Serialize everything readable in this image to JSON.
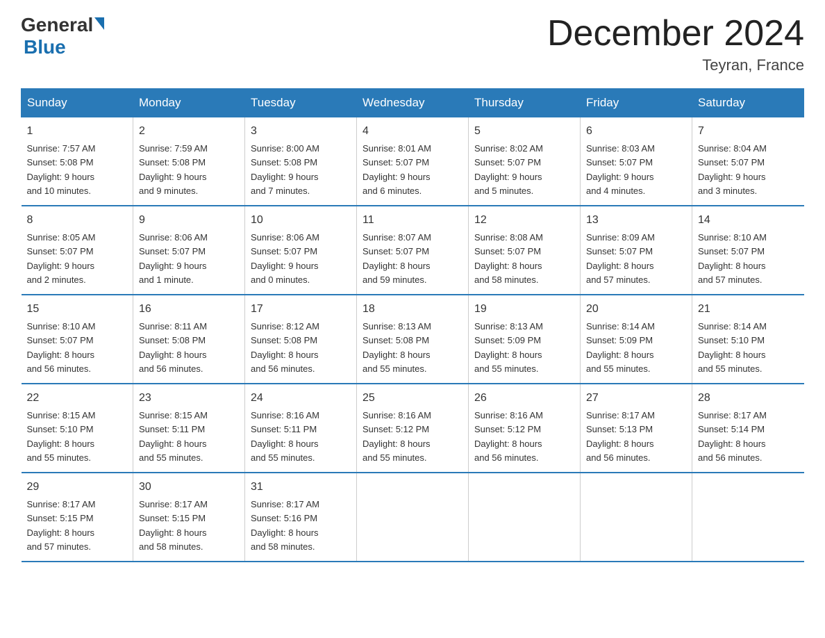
{
  "logo": {
    "general": "General",
    "blue": "Blue"
  },
  "title": "December 2024",
  "location": "Teyran, France",
  "days_of_week": [
    "Sunday",
    "Monday",
    "Tuesday",
    "Wednesday",
    "Thursday",
    "Friday",
    "Saturday"
  ],
  "weeks": [
    [
      {
        "num": "1",
        "sunrise": "Sunrise: 7:57 AM",
        "sunset": "Sunset: 5:08 PM",
        "daylight": "Daylight: 9 hours",
        "daylight2": "and 10 minutes."
      },
      {
        "num": "2",
        "sunrise": "Sunrise: 7:59 AM",
        "sunset": "Sunset: 5:08 PM",
        "daylight": "Daylight: 9 hours",
        "daylight2": "and 9 minutes."
      },
      {
        "num": "3",
        "sunrise": "Sunrise: 8:00 AM",
        "sunset": "Sunset: 5:08 PM",
        "daylight": "Daylight: 9 hours",
        "daylight2": "and 7 minutes."
      },
      {
        "num": "4",
        "sunrise": "Sunrise: 8:01 AM",
        "sunset": "Sunset: 5:07 PM",
        "daylight": "Daylight: 9 hours",
        "daylight2": "and 6 minutes."
      },
      {
        "num": "5",
        "sunrise": "Sunrise: 8:02 AM",
        "sunset": "Sunset: 5:07 PM",
        "daylight": "Daylight: 9 hours",
        "daylight2": "and 5 minutes."
      },
      {
        "num": "6",
        "sunrise": "Sunrise: 8:03 AM",
        "sunset": "Sunset: 5:07 PM",
        "daylight": "Daylight: 9 hours",
        "daylight2": "and 4 minutes."
      },
      {
        "num": "7",
        "sunrise": "Sunrise: 8:04 AM",
        "sunset": "Sunset: 5:07 PM",
        "daylight": "Daylight: 9 hours",
        "daylight2": "and 3 minutes."
      }
    ],
    [
      {
        "num": "8",
        "sunrise": "Sunrise: 8:05 AM",
        "sunset": "Sunset: 5:07 PM",
        "daylight": "Daylight: 9 hours",
        "daylight2": "and 2 minutes."
      },
      {
        "num": "9",
        "sunrise": "Sunrise: 8:06 AM",
        "sunset": "Sunset: 5:07 PM",
        "daylight": "Daylight: 9 hours",
        "daylight2": "and 1 minute."
      },
      {
        "num": "10",
        "sunrise": "Sunrise: 8:06 AM",
        "sunset": "Sunset: 5:07 PM",
        "daylight": "Daylight: 9 hours",
        "daylight2": "and 0 minutes."
      },
      {
        "num": "11",
        "sunrise": "Sunrise: 8:07 AM",
        "sunset": "Sunset: 5:07 PM",
        "daylight": "Daylight: 8 hours",
        "daylight2": "and 59 minutes."
      },
      {
        "num": "12",
        "sunrise": "Sunrise: 8:08 AM",
        "sunset": "Sunset: 5:07 PM",
        "daylight": "Daylight: 8 hours",
        "daylight2": "and 58 minutes."
      },
      {
        "num": "13",
        "sunrise": "Sunrise: 8:09 AM",
        "sunset": "Sunset: 5:07 PM",
        "daylight": "Daylight: 8 hours",
        "daylight2": "and 57 minutes."
      },
      {
        "num": "14",
        "sunrise": "Sunrise: 8:10 AM",
        "sunset": "Sunset: 5:07 PM",
        "daylight": "Daylight: 8 hours",
        "daylight2": "and 57 minutes."
      }
    ],
    [
      {
        "num": "15",
        "sunrise": "Sunrise: 8:10 AM",
        "sunset": "Sunset: 5:07 PM",
        "daylight": "Daylight: 8 hours",
        "daylight2": "and 56 minutes."
      },
      {
        "num": "16",
        "sunrise": "Sunrise: 8:11 AM",
        "sunset": "Sunset: 5:08 PM",
        "daylight": "Daylight: 8 hours",
        "daylight2": "and 56 minutes."
      },
      {
        "num": "17",
        "sunrise": "Sunrise: 8:12 AM",
        "sunset": "Sunset: 5:08 PM",
        "daylight": "Daylight: 8 hours",
        "daylight2": "and 56 minutes."
      },
      {
        "num": "18",
        "sunrise": "Sunrise: 8:13 AM",
        "sunset": "Sunset: 5:08 PM",
        "daylight": "Daylight: 8 hours",
        "daylight2": "and 55 minutes."
      },
      {
        "num": "19",
        "sunrise": "Sunrise: 8:13 AM",
        "sunset": "Sunset: 5:09 PM",
        "daylight": "Daylight: 8 hours",
        "daylight2": "and 55 minutes."
      },
      {
        "num": "20",
        "sunrise": "Sunrise: 8:14 AM",
        "sunset": "Sunset: 5:09 PM",
        "daylight": "Daylight: 8 hours",
        "daylight2": "and 55 minutes."
      },
      {
        "num": "21",
        "sunrise": "Sunrise: 8:14 AM",
        "sunset": "Sunset: 5:10 PM",
        "daylight": "Daylight: 8 hours",
        "daylight2": "and 55 minutes."
      }
    ],
    [
      {
        "num": "22",
        "sunrise": "Sunrise: 8:15 AM",
        "sunset": "Sunset: 5:10 PM",
        "daylight": "Daylight: 8 hours",
        "daylight2": "and 55 minutes."
      },
      {
        "num": "23",
        "sunrise": "Sunrise: 8:15 AM",
        "sunset": "Sunset: 5:11 PM",
        "daylight": "Daylight: 8 hours",
        "daylight2": "and 55 minutes."
      },
      {
        "num": "24",
        "sunrise": "Sunrise: 8:16 AM",
        "sunset": "Sunset: 5:11 PM",
        "daylight": "Daylight: 8 hours",
        "daylight2": "and 55 minutes."
      },
      {
        "num": "25",
        "sunrise": "Sunrise: 8:16 AM",
        "sunset": "Sunset: 5:12 PM",
        "daylight": "Daylight: 8 hours",
        "daylight2": "and 55 minutes."
      },
      {
        "num": "26",
        "sunrise": "Sunrise: 8:16 AM",
        "sunset": "Sunset: 5:12 PM",
        "daylight": "Daylight: 8 hours",
        "daylight2": "and 56 minutes."
      },
      {
        "num": "27",
        "sunrise": "Sunrise: 8:17 AM",
        "sunset": "Sunset: 5:13 PM",
        "daylight": "Daylight: 8 hours",
        "daylight2": "and 56 minutes."
      },
      {
        "num": "28",
        "sunrise": "Sunrise: 8:17 AM",
        "sunset": "Sunset: 5:14 PM",
        "daylight": "Daylight: 8 hours",
        "daylight2": "and 56 minutes."
      }
    ],
    [
      {
        "num": "29",
        "sunrise": "Sunrise: 8:17 AM",
        "sunset": "Sunset: 5:15 PM",
        "daylight": "Daylight: 8 hours",
        "daylight2": "and 57 minutes."
      },
      {
        "num": "30",
        "sunrise": "Sunrise: 8:17 AM",
        "sunset": "Sunset: 5:15 PM",
        "daylight": "Daylight: 8 hours",
        "daylight2": "and 58 minutes."
      },
      {
        "num": "31",
        "sunrise": "Sunrise: 8:17 AM",
        "sunset": "Sunset: 5:16 PM",
        "daylight": "Daylight: 8 hours",
        "daylight2": "and 58 minutes."
      },
      {
        "num": "",
        "sunrise": "",
        "sunset": "",
        "daylight": "",
        "daylight2": ""
      },
      {
        "num": "",
        "sunrise": "",
        "sunset": "",
        "daylight": "",
        "daylight2": ""
      },
      {
        "num": "",
        "sunrise": "",
        "sunset": "",
        "daylight": "",
        "daylight2": ""
      },
      {
        "num": "",
        "sunrise": "",
        "sunset": "",
        "daylight": "",
        "daylight2": ""
      }
    ]
  ]
}
